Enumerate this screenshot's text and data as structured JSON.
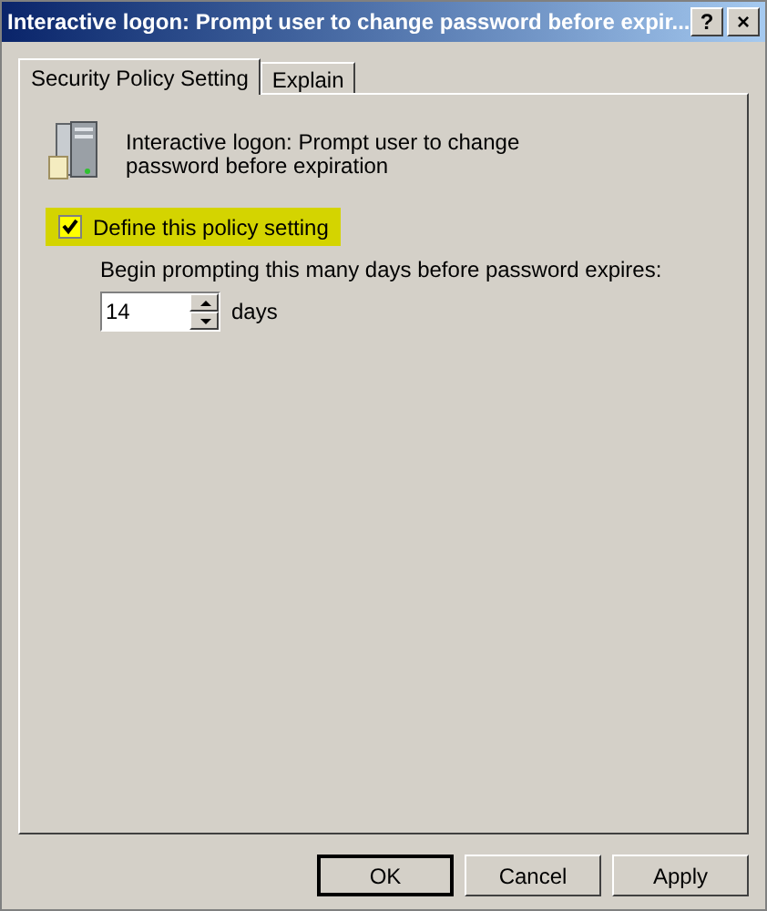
{
  "window": {
    "title": "Interactive logon: Prompt user to change password before expir...",
    "title_buttons": [
      "?",
      "×"
    ]
  },
  "tabs": [
    {
      "label": "Security Policy Setting",
      "selected": true
    },
    {
      "label": "Explain",
      "selected": false
    }
  ],
  "policy": {
    "name": "Interactive logon: Prompt user to change password before expiration"
  },
  "define_setting": {
    "label": "Define this policy setting",
    "checked": true,
    "highlighted": true
  },
  "days_prompt": {
    "label": "Begin prompting this many days before password expires:",
    "value": "14",
    "unit": "days",
    "disabled": false
  },
  "buttons": [
    {
      "label": "OK",
      "default": true
    },
    {
      "label": "Cancel",
      "default": false
    },
    {
      "label": "Apply",
      "default": false
    }
  ]
}
